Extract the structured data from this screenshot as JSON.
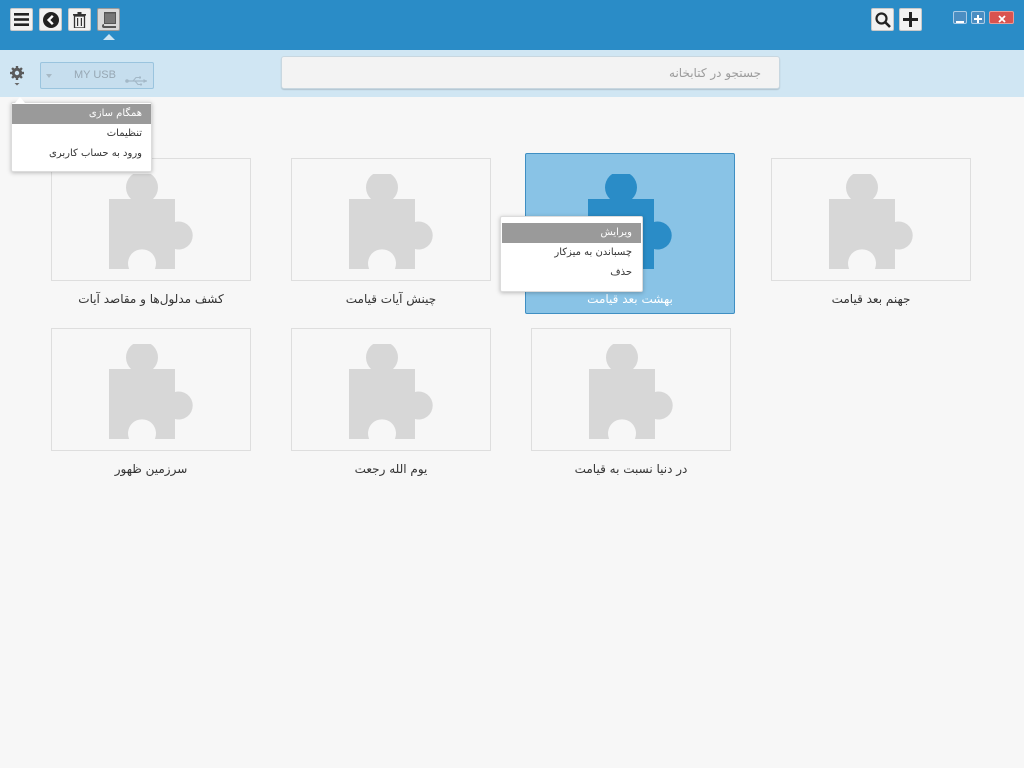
{
  "colors": {
    "topbar": "#2a8cc7",
    "subbar": "#d0e6f3",
    "selected_tile": "#89c3e6",
    "selected_icon": "#2a8cc7",
    "icon": "#d7d7d7",
    "menu_highlight": "#9a9a9a",
    "close": "#d9534f"
  },
  "toolbar": {
    "left_icons": [
      "menu-icon",
      "back-icon",
      "trash-icon",
      "book-icon"
    ],
    "right_icons": [
      "search-icon",
      "plus-icon"
    ],
    "window_controls": [
      "minimize-icon",
      "maximize-icon",
      "close-icon"
    ]
  },
  "device": {
    "label": "MY USB"
  },
  "search": {
    "placeholder": "جستجو در کتابخانه"
  },
  "settings_menu": {
    "items": [
      "همگام سازی",
      "تنظیمات",
      "ورود به حساب کاربری"
    ],
    "highlighted_index": 0
  },
  "context_menu": {
    "items": [
      "ویرایش",
      "چسباندن به میزکار",
      "حذف"
    ],
    "highlighted_index": 0
  },
  "books": [
    {
      "title": "جهنم بعد قیامت",
      "selected": false
    },
    {
      "title": "بهشت بعد قیامت",
      "selected": true
    },
    {
      "title": "چینش آیات قیامت",
      "selected": false
    },
    {
      "title": "کشف مدلول‌ها و مقاصد آیات",
      "selected": false
    },
    {
      "title": "در دنیا نسبت به قیامت",
      "selected": false
    },
    {
      "title": "یوم الله رجعت",
      "selected": false
    },
    {
      "title": "سرزمین ظهور",
      "selected": false
    }
  ]
}
